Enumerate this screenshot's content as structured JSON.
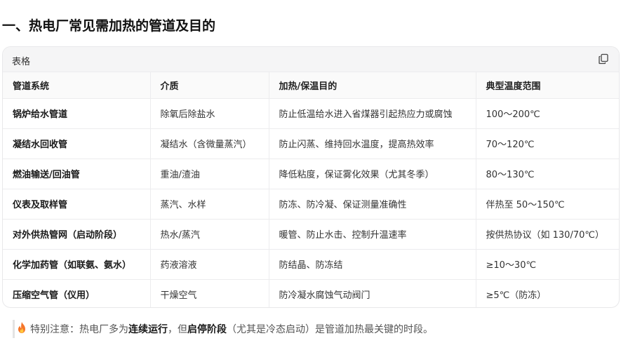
{
  "page": {
    "title": "一、热电厂常见需加热的管道及目的"
  },
  "table_card": {
    "label": "表格",
    "copy_icon": "copy-icon"
  },
  "table": {
    "headers": [
      "管道系统",
      "介质",
      "加热/保温目的",
      "典型温度范围"
    ],
    "rows": [
      [
        "锅炉给水管道",
        "除氧后除盐水",
        "防止低温给水进入省煤器引起热应力或腐蚀",
        "100～200℃"
      ],
      [
        "凝结水回收管",
        "凝结水（含微量蒸汽）",
        "防止闪蒸、维持回水温度，提高热效率",
        "70～120℃"
      ],
      [
        "燃油输送/回油管",
        "重油/渣油",
        "降低粘度，保证雾化效果（尤其冬季）",
        "80～130℃"
      ],
      [
        "仪表及取样管",
        "蒸汽、水样",
        "防冻、防冷凝、保证测量准确性",
        "伴热至 50～150℃"
      ],
      [
        "对外供热管网（启动阶段）",
        "热水/蒸汽",
        "暖管、防止水击、控制升温速率",
        "按供热协议（如 130/70℃）"
      ],
      [
        "化学加药管（如联氨、氨水）",
        "药液溶液",
        "防结晶、防冻结",
        "≥10～30℃"
      ],
      [
        "压缩空气管（仪用）",
        "干燥空气",
        "防冷凝水腐蚀气动阀门",
        "≥5℃（防冻）"
      ]
    ]
  },
  "note": {
    "icon": "fire-icon",
    "prefix": "特别注意：热电厂多为",
    "bold1": "连续运行",
    "middle": "，但",
    "bold2": "启停阶段",
    "suffix": "（尤其是冷态启动）是管道加热最关键的时段。"
  }
}
